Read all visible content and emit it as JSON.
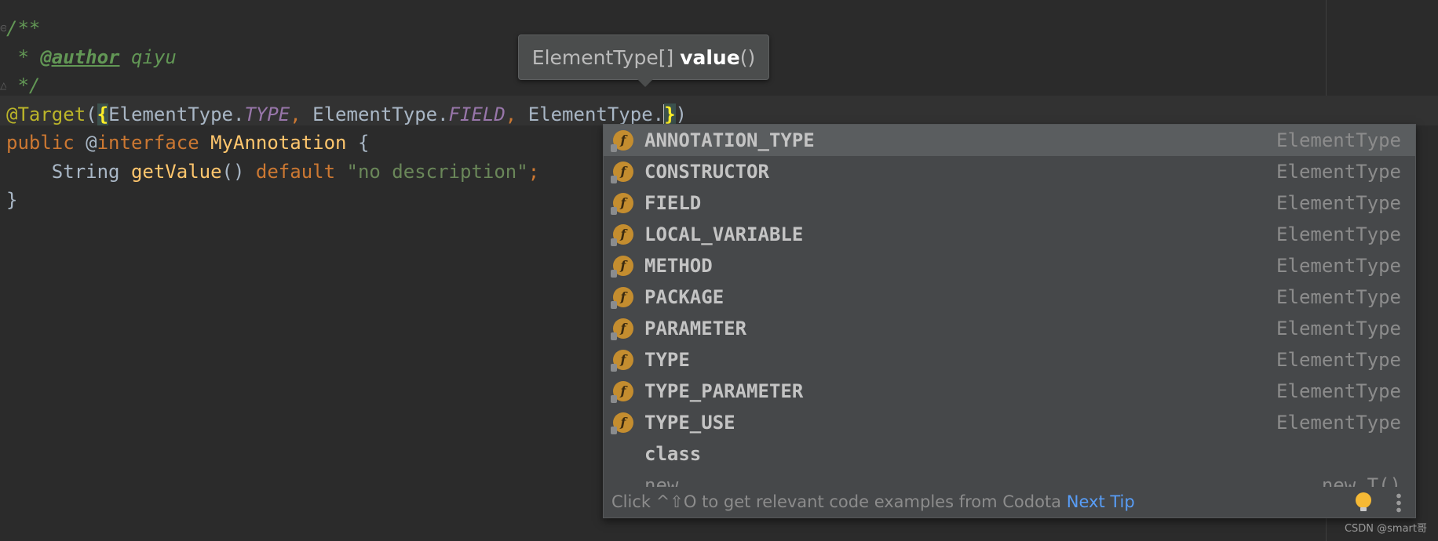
{
  "editor": {
    "lines": [
      {
        "fold": "⊖",
        "segments": [
          {
            "text": "/**",
            "cls": "c-doc"
          }
        ]
      },
      {
        "fold": "",
        "segments": [
          {
            "text": " * ",
            "cls": "c-doc"
          },
          {
            "text": "@author",
            "cls": "c-tag"
          },
          {
            "text": " qiyu",
            "cls": "c-doc"
          }
        ]
      },
      {
        "fold": "△",
        "segments": [
          {
            "text": " */",
            "cls": "c-doc"
          }
        ]
      },
      {
        "fold": "",
        "segments": [
          {
            "text": "@Target",
            "cls": "c-ann"
          },
          {
            "text": "(",
            "cls": "c-plain"
          },
          {
            "text": "{",
            "cls": "brace-hl"
          },
          {
            "text": "ElementType.",
            "cls": "c-plain"
          },
          {
            "text": "TYPE",
            "cls": "c-const"
          },
          {
            "text": ", ",
            "cls": "c-kw"
          },
          {
            "text": "ElementType.",
            "cls": "c-plain"
          },
          {
            "text": "FIELD",
            "cls": "c-const"
          },
          {
            "text": ", ",
            "cls": "c-kw"
          },
          {
            "text": "ElementType.",
            "cls": "c-plain"
          },
          {
            "caret": true
          },
          {
            "text": "}",
            "cls": "brace-hl"
          },
          {
            "text": ")",
            "cls": "c-plain"
          }
        ]
      },
      {
        "fold": "",
        "segments": [
          {
            "text": "public ",
            "cls": "c-kw"
          },
          {
            "text": "@",
            "cls": "c-plain"
          },
          {
            "text": "interface ",
            "cls": "c-kw"
          },
          {
            "text": "MyAnnotation",
            "cls": "c-method"
          },
          {
            "text": " {",
            "cls": "c-plain"
          }
        ]
      },
      {
        "fold": "",
        "segments": [
          {
            "text": "    String ",
            "cls": "c-plain"
          },
          {
            "text": "getValue",
            "cls": "c-method"
          },
          {
            "text": "() ",
            "cls": "c-plain"
          },
          {
            "text": "default ",
            "cls": "c-kw"
          },
          {
            "text": "\"no description\"",
            "cls": "c-str"
          },
          {
            "text": ";",
            "cls": "c-kw"
          }
        ]
      },
      {
        "fold": "",
        "segments": [
          {
            "text": "}",
            "cls": "c-plain"
          }
        ]
      }
    ]
  },
  "param_tip": {
    "prefix": "ElementType[] ",
    "bold": "value",
    "suffix": "()"
  },
  "completion": {
    "items": [
      {
        "name": "ANNOTATION_TYPE",
        "type": "ElementType",
        "icon": "field-icon",
        "selected": true
      },
      {
        "name": "CONSTRUCTOR",
        "type": "ElementType",
        "icon": "field-icon"
      },
      {
        "name": "FIELD",
        "type": "ElementType",
        "icon": "field-icon"
      },
      {
        "name": "LOCAL_VARIABLE",
        "type": "ElementType",
        "icon": "field-icon"
      },
      {
        "name": "METHOD",
        "type": "ElementType",
        "icon": "field-icon"
      },
      {
        "name": "PACKAGE",
        "type": "ElementType",
        "icon": "field-icon"
      },
      {
        "name": "PARAMETER",
        "type": "ElementType",
        "icon": "field-icon"
      },
      {
        "name": "TYPE",
        "type": "ElementType",
        "icon": "field-icon"
      },
      {
        "name": "TYPE_PARAMETER",
        "type": "ElementType",
        "icon": "field-icon"
      },
      {
        "name": "TYPE_USE",
        "type": "ElementType",
        "icon": "field-icon"
      },
      {
        "name": "class",
        "type": ""
      },
      {
        "name": "new",
        "type": "new T()",
        "partial": true
      }
    ],
    "footer": {
      "hint": "Click ^⇧O to get relevant code examples from Codota",
      "next_tip": "Next Tip"
    }
  },
  "watermark": "CSDN @smart哥",
  "colors": {
    "background": "#2b2b2b",
    "popup": "#46484a",
    "selection": "#5a5d5f",
    "link": "#589df6",
    "field_icon": "#c48d2f"
  }
}
